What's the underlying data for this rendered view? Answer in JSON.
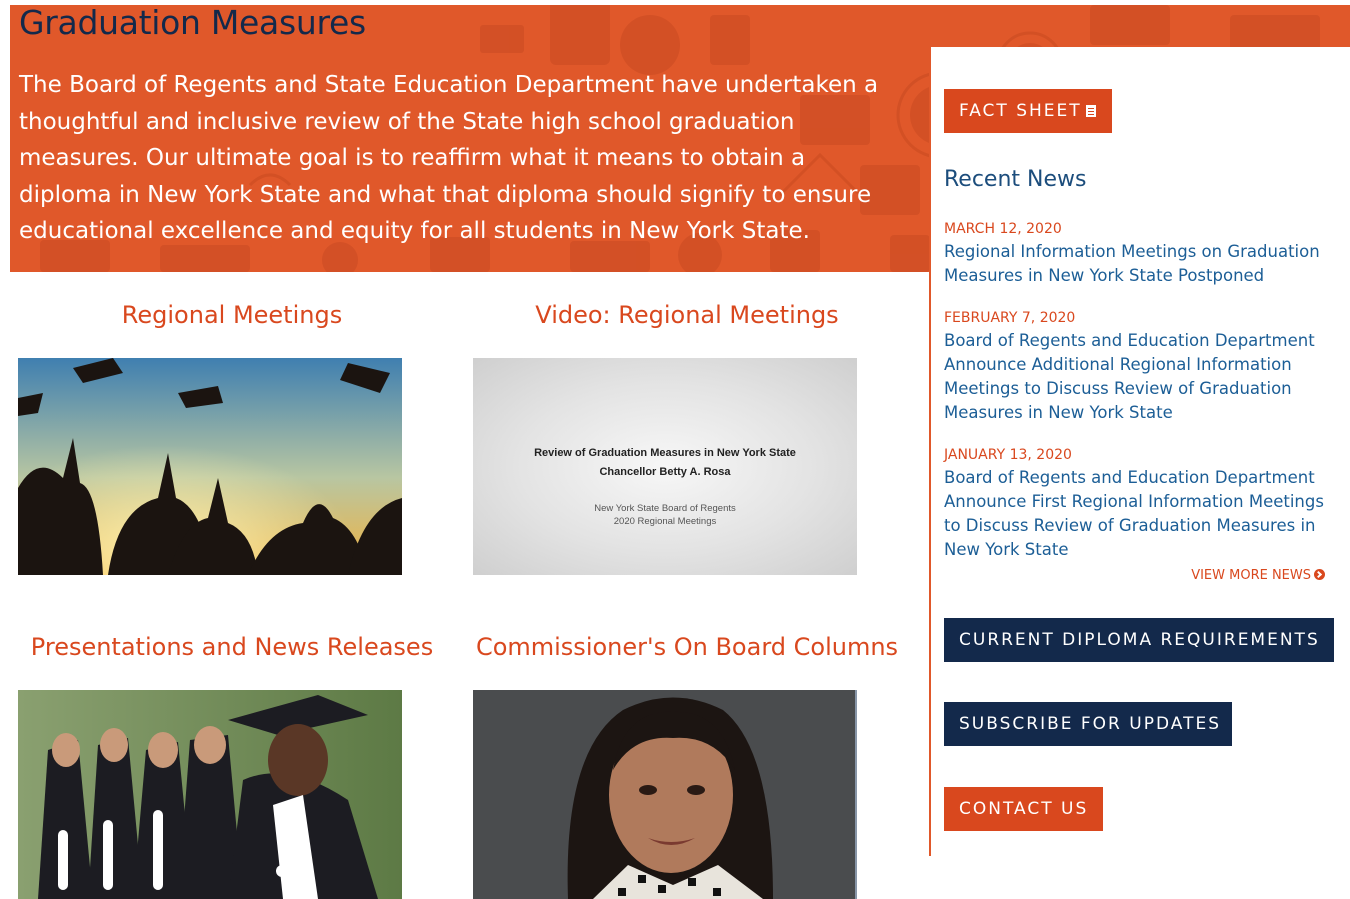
{
  "hero": {
    "title": "Graduation Measures",
    "text": "The Board of Regents and State Education Department have undertaken a thoughtful and inclusive review of the State high school graduation measures. Our ultimate goal is to reaffirm what it means to obtain a diploma in New York State and what that diploma should signify to ensure educational excellence and equity for all students in New York State."
  },
  "cards": [
    {
      "title": "Regional Meetings"
    },
    {
      "title": "Video: Regional Meetings",
      "video": {
        "line1": "Review of Graduation Measures in New York State",
        "line2": "Chancellor Betty A. Rosa",
        "line3": "New York State Board of Regents",
        "line4": "2020 Regional Meetings"
      }
    },
    {
      "title": "Presentations and News Releases"
    },
    {
      "title": "Commissioner's On Board Columns"
    }
  ],
  "sidebar": {
    "fact_sheet": "FACT SHEET",
    "recent_news_heading": "Recent News",
    "news": [
      {
        "date": "MARCH 12, 2020",
        "title": "Regional Information Meetings on Graduation Measures in New York State Postponed"
      },
      {
        "date": "FEBRUARY 7, 2020",
        "title": "Board of Regents and Education Department Announce Additional Regional Information Meetings to Discuss Review of Graduation Measures in New York State"
      },
      {
        "date": "JANUARY 13, 2020",
        "title": "Board of Regents and Education Department Announce First Regional Information Meetings to Discuss Review of Graduation Measures in New York State"
      }
    ],
    "view_more": "VIEW MORE NEWS",
    "diploma_button": "CURRENT DIPLOMA REQUIREMENTS",
    "subscribe_button": "SUBSCRIBE FOR UPDATES",
    "contact_button": "CONTACT US"
  },
  "colors": {
    "hero_orange": "#e0582a",
    "accent_orange": "#d9481e",
    "navy": "#13294b",
    "link_blue": "#1c5e96"
  }
}
